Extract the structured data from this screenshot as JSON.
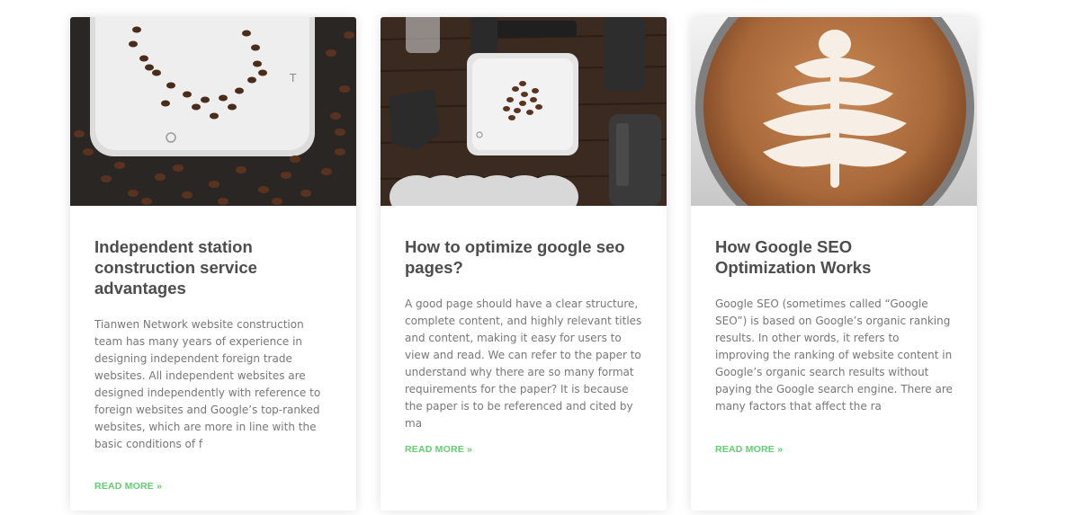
{
  "posts": [
    {
      "image_alt": "coffee scale with coffee beans",
      "title": "Independent station construction service advantages",
      "excerpt": "Tianwen Network website construction team has many years of experience in designing independent foreign trade websites. All independent websites are designed independently with reference to foreign websites and Google’s top-ranked websites, which are more in line with the basic conditions of f",
      "read_more": "READ MORE »"
    },
    {
      "image_alt": "aeropress coffee tools on wooden table",
      "title": "How to optimize google seo pages?",
      "excerpt": "A good page should have a clear structure, complete content, and highly relevant titles and content, making it easy for users to view and read. We can refer to the paper to understand why there are so many format requirements for the paper? It is because the paper is to be referenced and cited by ma",
      "read_more": "READ MORE »"
    },
    {
      "image_alt": "latte art in a cup",
      "title": "How Google SEO Optimization Works",
      "excerpt": "Google SEO (sometimes called “Google SEO”) is based on Google’s organic ranking results. In other words, it refers to improving the ranking of website content in Google’s organic search results without paying the Google search engine. There are many factors that affect the ra",
      "read_more": "READ MORE »"
    }
  ],
  "colors": {
    "accent": "#61ce70",
    "title": "#4d4d4d",
    "text": "#777777"
  }
}
